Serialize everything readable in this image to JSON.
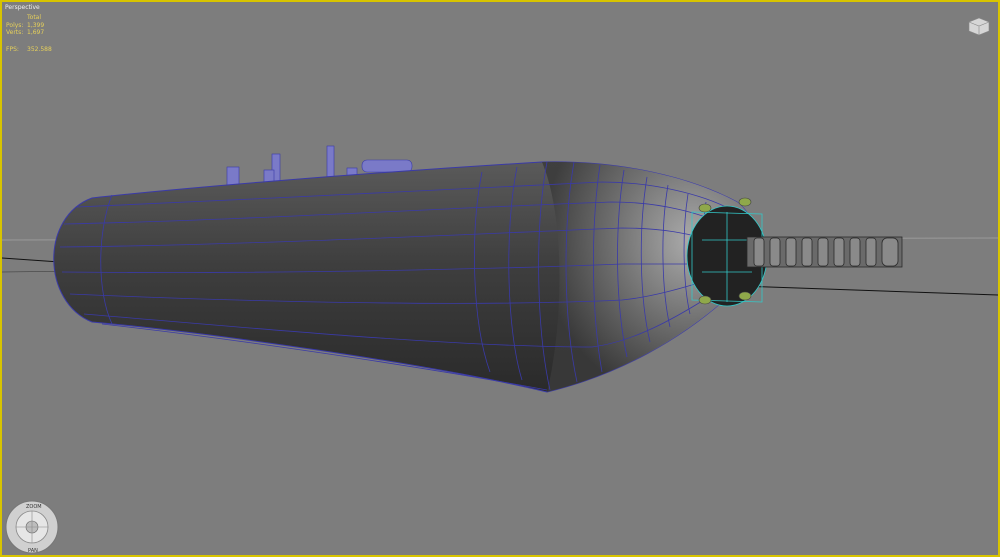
{
  "viewport": {
    "name": "Perspective"
  },
  "stats": {
    "header": "Total",
    "rows": [
      {
        "key": "Polys:",
        "value": "1,399"
      },
      {
        "key": "Verts:",
        "value": "1,697"
      }
    ],
    "fps_key": "FPS:",
    "fps_value": "352.588"
  },
  "nav_wheel": {
    "zoom_label": "ZOOM",
    "pan_label": "PAN"
  },
  "colors": {
    "viewport_border": "#d8c400",
    "background": "#7d7d7d",
    "wireframe": "#3a3aa8",
    "selection": "#33c9c9",
    "stat_text": "#e6d05a"
  }
}
